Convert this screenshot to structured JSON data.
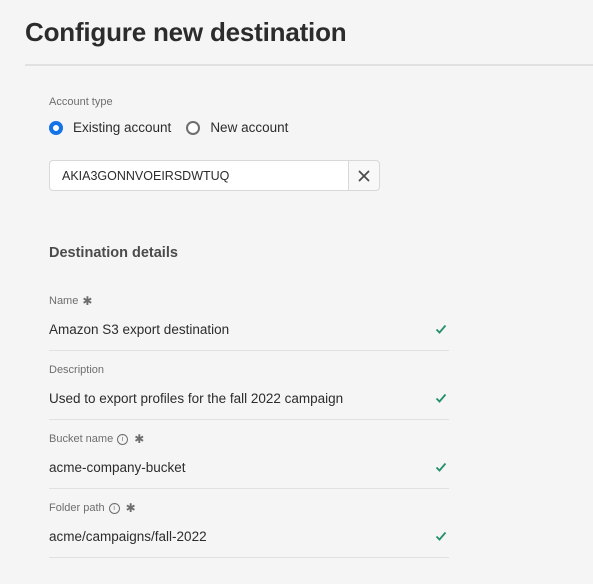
{
  "header": {
    "title": "Configure new destination"
  },
  "account": {
    "label": "Account type",
    "options": [
      {
        "label": "Existing account",
        "checked": true
      },
      {
        "label": "New account",
        "checked": false
      }
    ],
    "selected_account": "AKIA3GONNVOEIRSDWTUQ",
    "clear_icon": "close-icon"
  },
  "details": {
    "heading": "Destination details",
    "fields": [
      {
        "label": "Name",
        "required": true,
        "info": false,
        "value": "Amazon S3 export destination",
        "valid": true
      },
      {
        "label": "Description",
        "required": false,
        "info": false,
        "value": "Used to export profiles for the fall 2022 campaign",
        "valid": true
      },
      {
        "label": "Bucket name",
        "required": true,
        "info": true,
        "value": "acme-company-bucket",
        "valid": true
      },
      {
        "label": "Folder path",
        "required": true,
        "info": true,
        "value": "acme/campaigns/fall-2022",
        "valid": true
      }
    ]
  },
  "colors": {
    "accent": "#1473e6",
    "valid": "#268e6c"
  }
}
